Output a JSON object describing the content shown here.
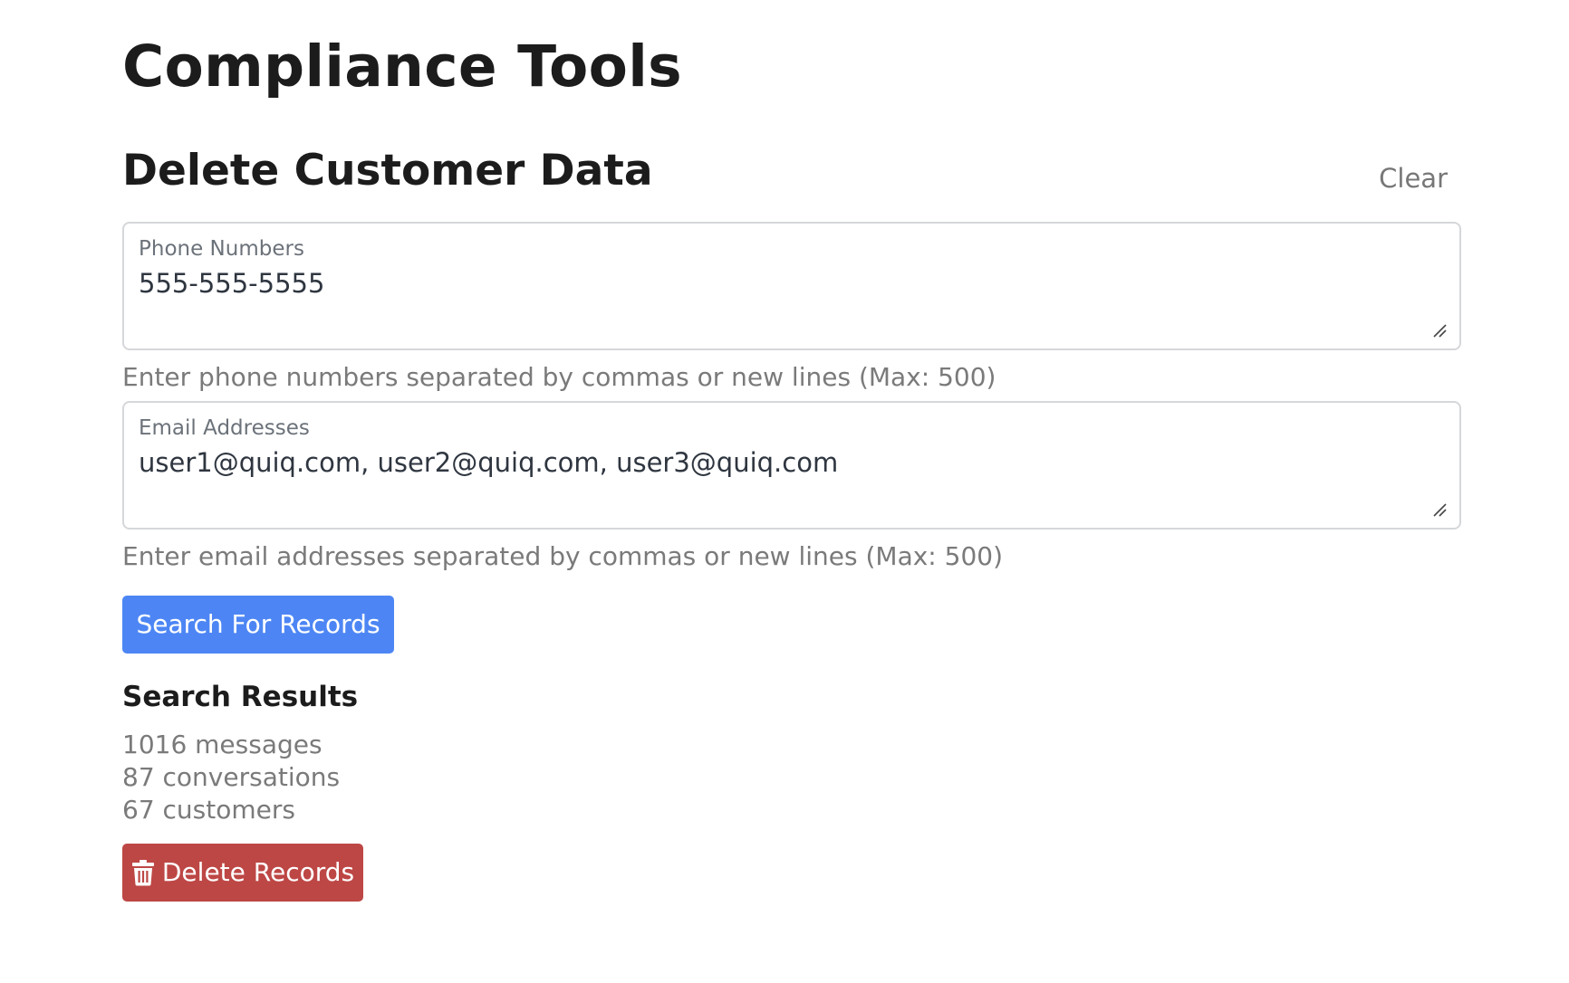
{
  "page": {
    "title": "Compliance Tools"
  },
  "section": {
    "title": "Delete Customer Data",
    "clear_label": "Clear"
  },
  "phone_field": {
    "label": "Phone Numbers",
    "value": "555-555-5555",
    "helper": "Enter phone numbers separated by commas or new lines (Max: 500)"
  },
  "email_field": {
    "label": "Email Addresses",
    "value": "user1@quiq.com, user2@quiq.com, user3@quiq.com",
    "helper": "Enter email addresses separated by commas or new lines (Max: 500)"
  },
  "search_button": {
    "label": "Search For Records"
  },
  "results": {
    "title": "Search Results",
    "items": [
      "1016 messages",
      "87 conversations",
      "67 customers"
    ]
  },
  "delete_button": {
    "label": "Delete Records",
    "icon": "trash-icon"
  },
  "colors": {
    "primary": "#4d86f4",
    "danger": "#bd4745",
    "muted_text": "#7a7a7a",
    "border": "#d5d7da"
  }
}
